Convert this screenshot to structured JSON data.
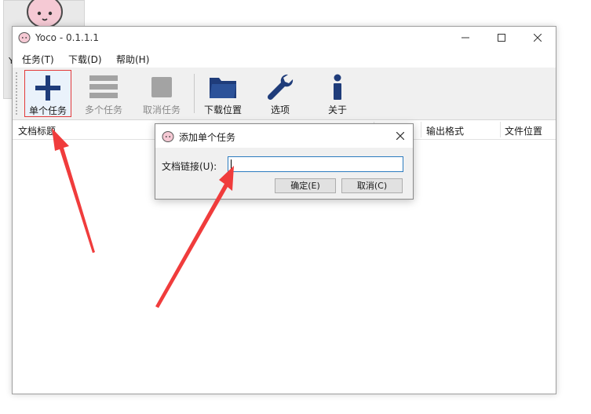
{
  "desktop": {
    "icon_label": "Y"
  },
  "window": {
    "title": "Yoco - 0.1.1.1"
  },
  "menu": [
    {
      "label": "任务(T)"
    },
    {
      "label": "下载(D)"
    },
    {
      "label": "帮助(H)"
    }
  ],
  "toolbar": {
    "buttons": [
      {
        "label": "单个任务",
        "icon": "plus-icon",
        "state": "active"
      },
      {
        "label": "多个任务",
        "icon": "list-icon",
        "state": "disabled"
      },
      {
        "label": "取消任务",
        "icon": "stop-icon",
        "state": "disabled"
      },
      {
        "label": "下载位置",
        "icon": "folder-icon",
        "state": "enabled"
      },
      {
        "label": "选项",
        "icon": "wrench-icon",
        "state": "enabled"
      },
      {
        "label": "关于",
        "icon": "info-icon",
        "state": "enabled"
      }
    ]
  },
  "list": {
    "columns": [
      "文档标题",
      "输出格式",
      "文件位置"
    ]
  },
  "dialog": {
    "title": "添加单个任务",
    "field_label": "文档链接(U):",
    "field_value": "",
    "ok_label": "确定(E)",
    "cancel_label": "取消(C)"
  },
  "colors": {
    "accent_blue": "#1f3c7a",
    "highlight_red": "#e33a3a",
    "disabled_gray": "#9a9a9a"
  }
}
